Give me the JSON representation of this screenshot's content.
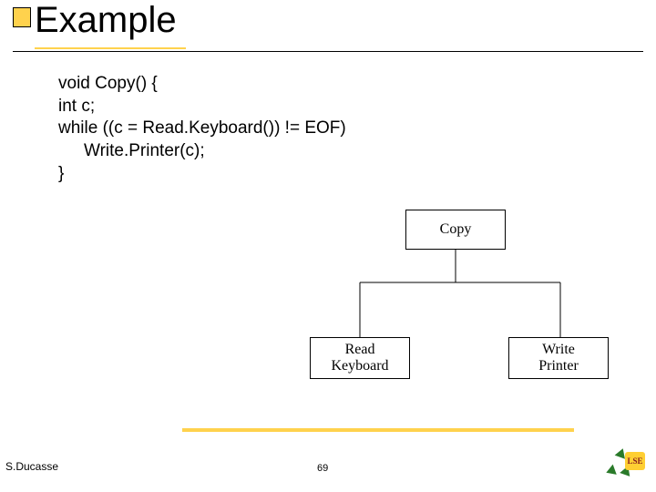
{
  "title": "Example",
  "code": {
    "l1": "void Copy() {",
    "l2": "int c;",
    "l3": "while ((c = Read.Keyboard()) != EOF)",
    "l4": "Write.Printer(c);",
    "l5": "}"
  },
  "diagram": {
    "top": "Copy",
    "left_l1": "Read",
    "left_l2": "Keyboard",
    "right_l1": "Write",
    "right_l2": "Printer"
  },
  "footer": {
    "author": "S.Ducasse",
    "page": "69"
  },
  "logo": {
    "badge": "LSE"
  }
}
